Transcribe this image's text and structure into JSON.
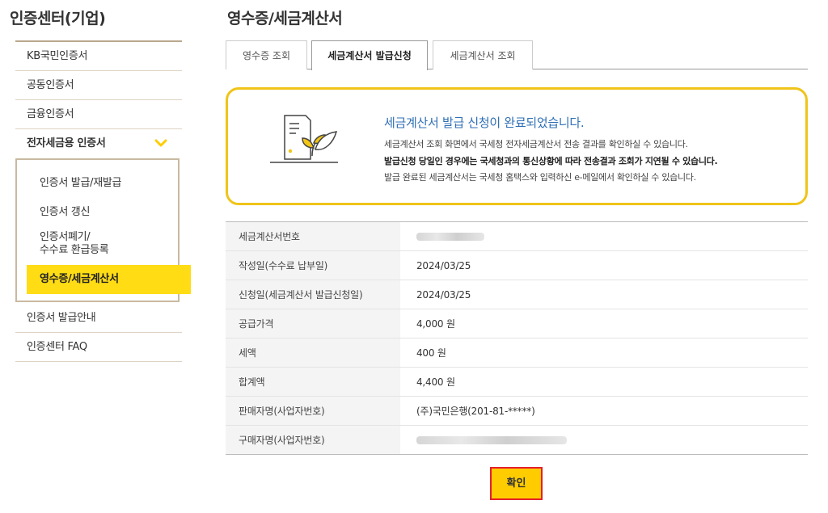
{
  "sidebar": {
    "title": "인증센터(기업)",
    "items": [
      {
        "label": "KB국민인증서"
      },
      {
        "label": "공동인증서"
      },
      {
        "label": "금융인증서"
      },
      {
        "label": "전자세금용 인증서"
      }
    ],
    "submenu": [
      {
        "label": "인증서 발급/재발급"
      },
      {
        "label": "인증서 갱신"
      },
      {
        "label": "인증서폐기/",
        "label2": "수수료 환급등록"
      },
      {
        "label": "영수증/세금계산서"
      }
    ],
    "after_items": [
      {
        "label": "인증서 발급안내"
      },
      {
        "label": "인증센터 FAQ"
      }
    ],
    "accent_color": "#ffdc14"
  },
  "main": {
    "title": "영수증/세금계산서",
    "tabs": [
      {
        "label": "영수증 조회",
        "selected": false
      },
      {
        "label": "세금계산서 발급신청",
        "selected": true
      },
      {
        "label": "세금계산서 조회",
        "selected": false
      }
    ],
    "notice": {
      "icon": "document-leaf-icon",
      "heading": "세금계산서 발급 신청이 완료되었습니다.",
      "line1": "세금계산서 조회 화면에서 국세청 전자세금계산서 전송 결과를 확인하실 수 있습니다.",
      "line2": "발급신청 당일인 경우에는 국세청과의 통신상황에 따라 전송결과 조회가 지연될 수 있습니다.",
      "line3": "발급 완료된 세금계산서는 국세청 홈택스와 입력하신 e-메일에서 확인하실 수 있습니다.",
      "border_color": "#f0c419",
      "heading_color": "#2f6fb5"
    },
    "table": [
      {
        "label": "세금계산서번호",
        "value": ""
      },
      {
        "label": "작성일(수수료 납부일)",
        "value": "2024/03/25"
      },
      {
        "label": "신청일(세금계산서 발급신청일)",
        "value": "2024/03/25"
      },
      {
        "label": "공급가격",
        "value": "4,000 원"
      },
      {
        "label": "세액",
        "value": "400 원"
      },
      {
        "label": "합계액",
        "value": "4,400 원"
      },
      {
        "label": "판매자명(사업자번호)",
        "value": "(주)국민은행(201-81-*****)"
      },
      {
        "label": "구매자명(사업자번호)",
        "value": ""
      }
    ],
    "confirm_label": "확인",
    "confirm_color": "#ffcc00"
  }
}
